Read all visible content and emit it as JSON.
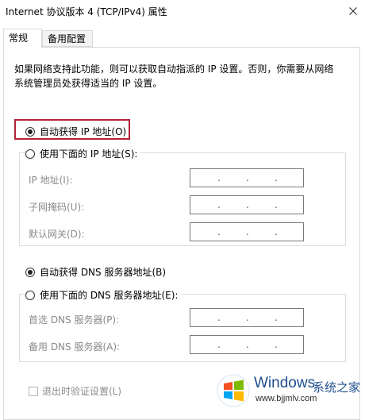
{
  "window": {
    "title": "Internet 协议版本 4 (TCP/IPv4) 属性",
    "close_icon": "close-icon"
  },
  "tabs": [
    {
      "label": "常规",
      "active": true
    },
    {
      "label": "备用配置",
      "active": false
    }
  ],
  "description": "如果网络支持此功能，则可以获取自动指派的 IP 设置。否则，你需要从网络系统管理员处获得适当的 IP 设置。",
  "ip_section": {
    "auto_label": "自动获得 IP 地址(O)",
    "auto_selected": true,
    "manual_label": "使用下面的 IP 地址(S):",
    "manual_selected": false,
    "fields": [
      {
        "label": "IP 地址(I):"
      },
      {
        "label": "子网掩码(U):"
      },
      {
        "label": "默认网关(D):"
      }
    ]
  },
  "dns_section": {
    "auto_label": "自动获得 DNS 服务器地址(B)",
    "auto_selected": true,
    "manual_label": "使用下面的 DNS 服务器地址(E):",
    "manual_selected": false,
    "fields": [
      {
        "label": "首选 DNS 服务器(P):"
      },
      {
        "label": "备用 DNS 服务器(A):"
      }
    ]
  },
  "validate_checkbox": {
    "label": "退出时验证设置(L)",
    "checked": false
  },
  "watermark": {
    "brand": "Windows",
    "suffix": "系统之家",
    "url": "www.bjjmlv.com"
  },
  "highlight_color": "#b2213a"
}
